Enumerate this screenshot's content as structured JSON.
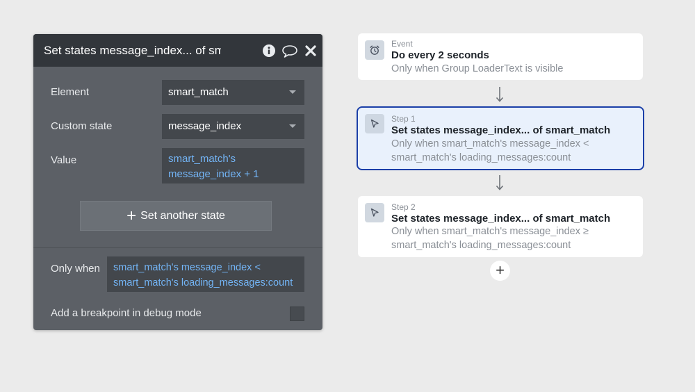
{
  "editor": {
    "title": "Set states message_index... of smart_match",
    "element_label": "Element",
    "element_value": "smart_match",
    "custom_state_label": "Custom state",
    "custom_state_value": "message_index",
    "value_label": "Value",
    "value_expr_line1": "smart_match's",
    "value_expr_line2": "message_index + 1",
    "set_another_label": "Set another state",
    "only_when_label": "Only when",
    "only_when_line1": "smart_match's message_index <",
    "only_when_line2": "smart_match's loading_messages:count",
    "breakpoint_label": "Add a breakpoint in debug mode",
    "icons": [
      "info-icon",
      "comment-icon",
      "close-icon",
      "caret-down-icon"
    ]
  },
  "workflow": {
    "event": {
      "kicker": "Event",
      "title": "Do every 2 seconds",
      "condition_line1": "Only when Group LoaderText is visible",
      "icon": "alarm-clock-icon"
    },
    "steps": [
      {
        "kicker": "Step 1",
        "title": "Set states message_index... of smart_match",
        "condition_line1": "Only when smart_match's message_index <",
        "condition_line2": "smart_match's loading_messages:count",
        "icon": "cursor-icon",
        "selected": true
      },
      {
        "kicker": "Step 2",
        "title": "Set states message_index... of smart_match",
        "condition_line1": "Only when smart_match's message_index ≥",
        "condition_line2": "smart_match's loading_messages:count",
        "icon": "cursor-icon",
        "selected": false
      }
    ],
    "add_step_label": "+"
  },
  "colors": {
    "canvas": "#ebebeb",
    "panel": "#5c6066",
    "panel_header": "#32363b",
    "field": "#43474c",
    "expression": "#73b4f5",
    "selected_border": "#1b3fa8",
    "selected_fill": "#e9f1fc"
  }
}
